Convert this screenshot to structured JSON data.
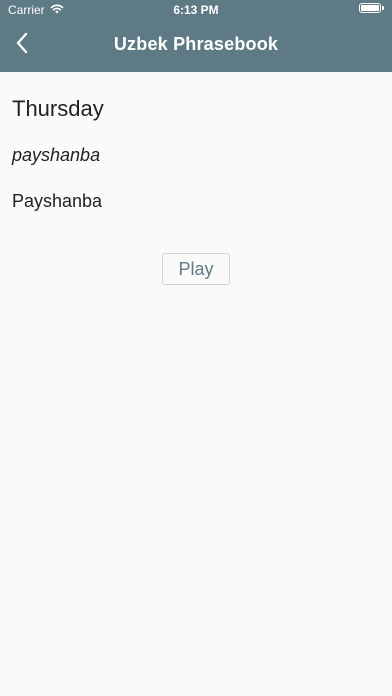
{
  "status_bar": {
    "carrier": "Carrier",
    "time": "6:13 PM",
    "wifi_icon": "wifi-icon",
    "battery_icon": "battery-icon",
    "battery_level": 1.0
  },
  "nav": {
    "back_icon": "chevron-left-icon",
    "title": "Uzbek Phrasebook"
  },
  "phrase": {
    "english": "Thursday",
    "transliteration": "payshanba",
    "uzbek": "Payshanba"
  },
  "actions": {
    "play_label": "Play"
  },
  "colors": {
    "header_background": "#5e7a85",
    "header_text": "#ffffff",
    "page_background": "#fafafa",
    "play_text": "#5e7a85"
  }
}
